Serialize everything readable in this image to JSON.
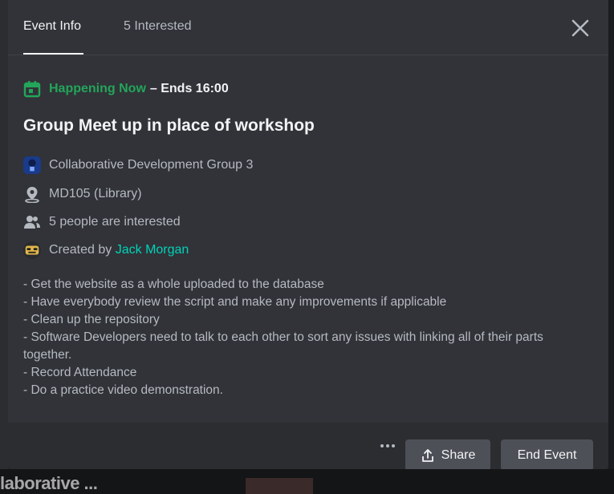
{
  "tabs": [
    {
      "label": "Event Info",
      "active": true
    },
    {
      "label": "5 Interested",
      "active": false
    }
  ],
  "status": {
    "now": "Happening Now",
    "ends": "– Ends 16:00",
    "color": "#23a55a"
  },
  "event": {
    "title": "Group Meet up in place of workshop",
    "server": "Collaborative Development Group 3",
    "location": "MD105 (Library)",
    "interested": "5 people are interested",
    "created_prefix": "Created by",
    "creator": "Jack Morgan",
    "creator_color": "#00d3b8"
  },
  "description": [
    "- Get the website as a whole uploaded to the database",
    "- Have everybody review the script and make any improvements if applicable",
    "- Clean up the repository",
    "- Software Developers need to talk to each other to sort any issues with linking all of their parts together.",
    "- Record Attendance",
    "- Do a practice video demonstration."
  ],
  "footer": {
    "share_label": "Share",
    "end_label": "End Event"
  },
  "background": {
    "partial_text": "laborative ..."
  },
  "icons": {
    "close": "close-icon",
    "calendar": "calendar-icon",
    "server": "server-avatar-icon",
    "location": "location-pin-icon",
    "people": "people-icon",
    "creator_avatar": "creator-avatar-icon",
    "more": "more-options-icon",
    "share": "share-icon"
  }
}
